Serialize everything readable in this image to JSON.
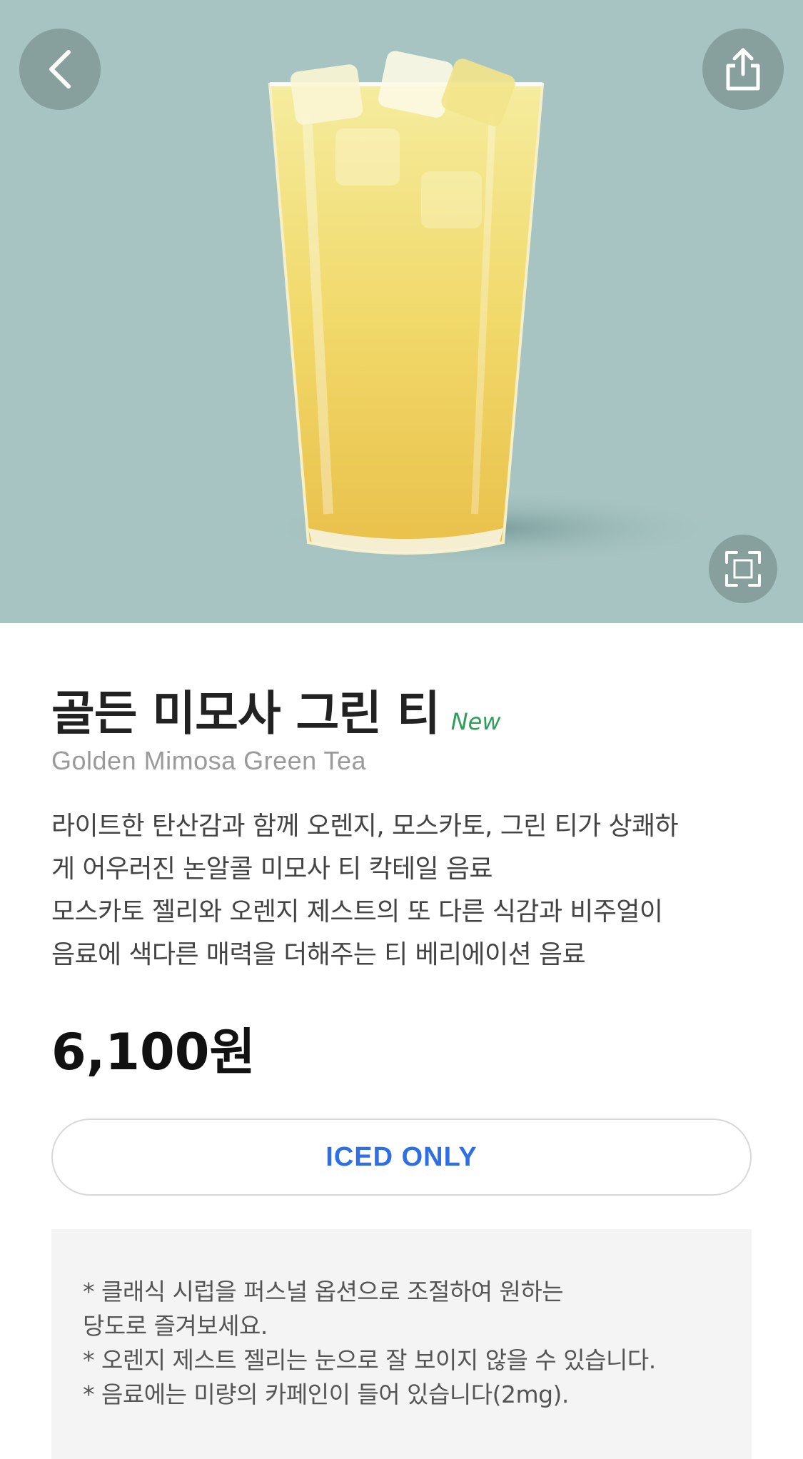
{
  "header": {
    "back_icon": "chevron-left-icon",
    "share_icon": "share-icon",
    "expand_icon": "expand-icon"
  },
  "product": {
    "name_ko": "골든 미모사 그린 티",
    "badge": "New",
    "name_en": "Golden Mimosa Green Tea",
    "description_lines": [
      "라이트한 탄산감과 함께 오렌지, 모스카토, 그린 티가 상쾌하",
      "게 어우러진 논알콜 미모사 티 칵테일 음료",
      "모스카토 젤리와 오렌지 제스트의 또 다른 식감과 비주얼이",
      "음료에 색다른 매력을 더해주는 티 베리에이션 음료"
    ],
    "price": "6,100원",
    "temperature_option": "ICED ONLY",
    "notice_lines": [
      "* 클래식 시럽을 퍼스널 옵션으로 조절하여 원하는",
      "당도로 즐겨보세요.",
      "* 오렌지 제스트 젤리는 눈으로 잘 보이지 않을 수 있습니다.",
      "* 음료에는 미량의 카페인이 들어 있습니다(2mg)."
    ]
  },
  "colors": {
    "hero_bg": "#a7c4c2",
    "badge": "#2e9e5b",
    "accent": "#2e6fe6"
  }
}
